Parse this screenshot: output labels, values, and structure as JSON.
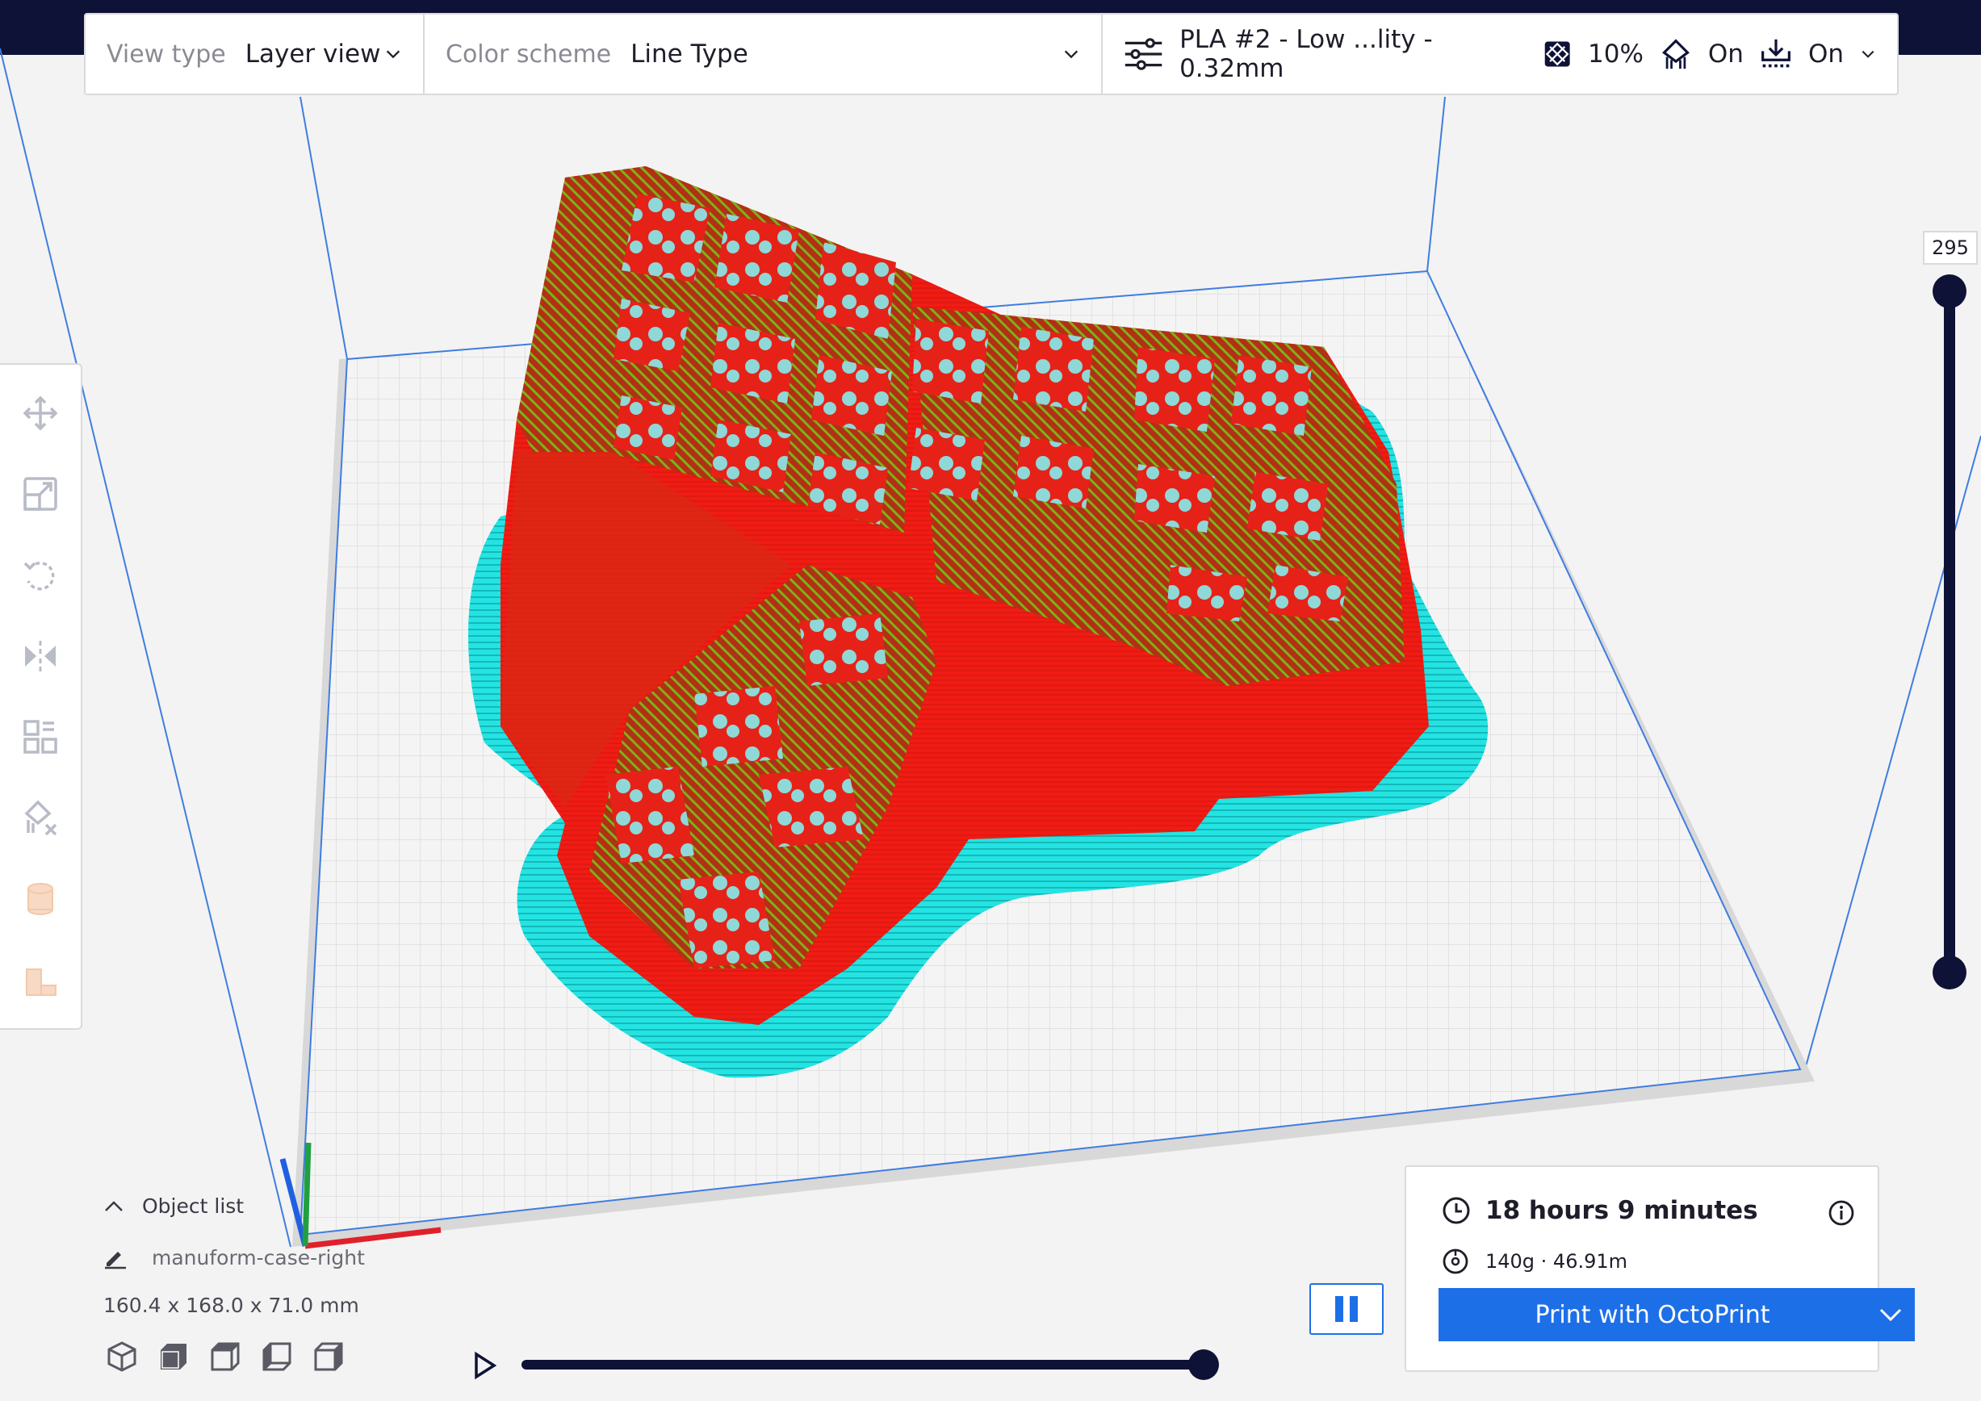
{
  "header": {
    "view_type_label": "View type",
    "view_type_value": "Layer view",
    "color_scheme_label": "Color scheme",
    "color_scheme_value": "Line Type",
    "profile": "PLA #2 - Low ...lity - 0.32mm",
    "infill": "10%",
    "support": "On",
    "adhesion": "On",
    "icons": [
      "settings-sliders-icon",
      "infill-icon",
      "support-icon",
      "adhesion-icon",
      "chevron-down-icon"
    ]
  },
  "toolbar": {
    "tools": [
      "move-icon",
      "scale-icon",
      "rotate-icon",
      "mirror-icon",
      "per-model-settings-icon",
      "support-blocker-icon",
      "cylinder-icon",
      "custom-support-icon"
    ]
  },
  "layer": {
    "current": "295"
  },
  "object_list": {
    "heading": "Object list",
    "object_name": "manuform-case-right",
    "dimensions": "160.4 x 168.0 x 71.0 mm"
  },
  "print": {
    "time": "18 hours 9 minutes",
    "material": "140g · 46.91m",
    "button_label": "Print with OctoPrint"
  },
  "colors": {
    "topbar": "#0e1236",
    "accent": "#1d6fe8",
    "wall": "#f01c14",
    "skin": "#8aa016",
    "support": "#22e0e0"
  }
}
